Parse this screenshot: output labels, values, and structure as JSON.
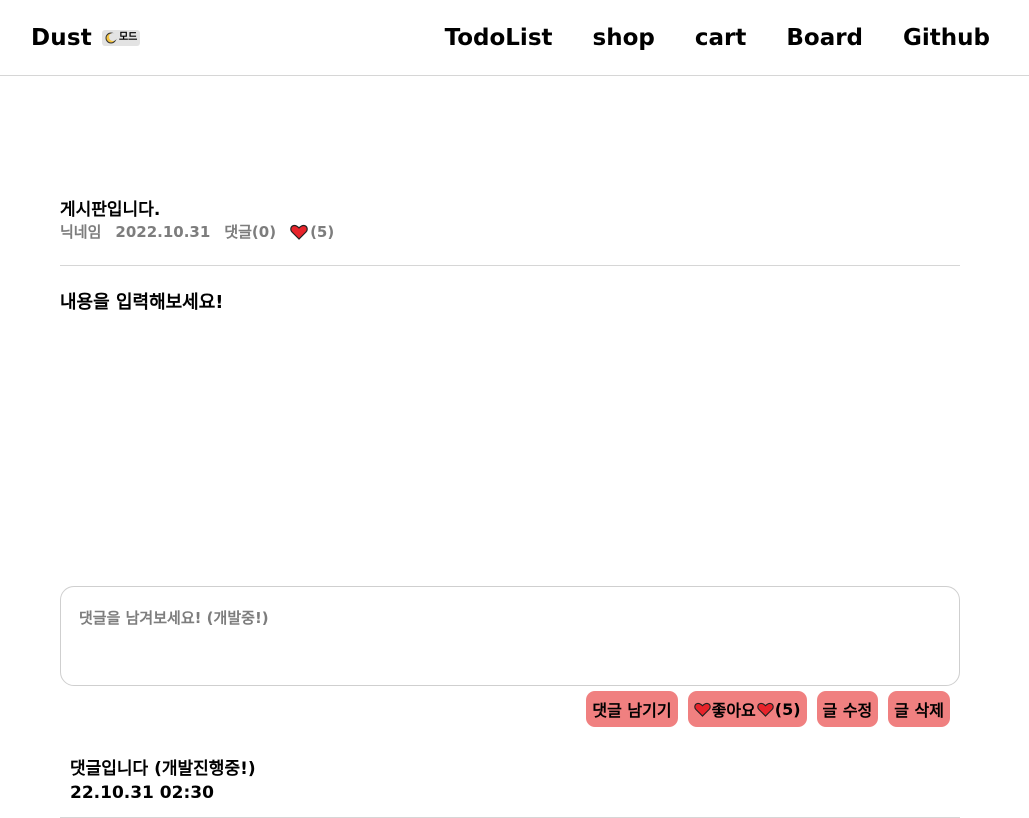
{
  "header": {
    "brand": "Dust",
    "mode_label": "모드",
    "nav": [
      {
        "label": "TodoList"
      },
      {
        "label": "shop"
      },
      {
        "label": "cart"
      },
      {
        "label": "Board"
      },
      {
        "label": "Github"
      }
    ]
  },
  "post": {
    "title": "게시판입니다.",
    "author": "닉네임",
    "date": "2022.10.31",
    "comments_label": "댓글(0)",
    "likes_label": "(5)",
    "body": "내용을 입력해보세요!"
  },
  "comment_input": {
    "placeholder": "댓글을 남겨보세요! (개발중!)",
    "value": ""
  },
  "actions": {
    "comment_label": "댓글 남기기",
    "like_label": "좋아요",
    "like_count": "(5)",
    "edit_label": "글 수정",
    "delete_label": "글 삭제"
  },
  "comments": [
    {
      "text": "댓글입니다 (개발진행중!)",
      "date": "22.10.31  02:30"
    }
  ],
  "colors": {
    "accent": "#f08080",
    "heart": "#e8242b",
    "muted_text": "#7d7d7d",
    "divider": "#d6d6d6"
  },
  "icons": {
    "mode": "moon-icon",
    "like": "heart-icon"
  }
}
